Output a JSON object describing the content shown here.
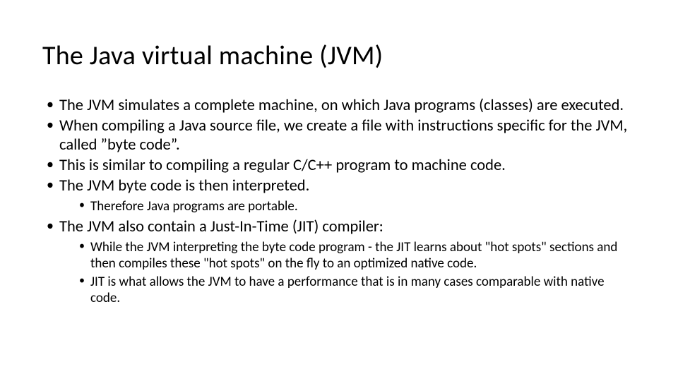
{
  "title": "The Java virtual machine (JVM)",
  "bullets": {
    "b1": "The JVM simulates a complete machine, on which Java programs (classes) are executed.",
    "b2": "When compiling a Java source file, we create a file with instructions specific for the JVM, called ”byte code”.",
    "b3": "This is similar to compiling a regular C/C++ program to machine code.",
    "b4": "The JVM byte code is then interpreted.",
    "b4_sub1": "Therefore Java programs are portable.",
    "b5": "The JVM also contain a Just-In-Time (JIT) compiler:",
    "b5_sub1": "While the JVM interpreting the byte code program - the JIT learns about \"hot spots\" sections and then compiles these \"hot spots\" on the fly to an optimized native code.",
    "b5_sub2": "JIT is what allows the JVM to have a performance that is in many cases comparable with native code."
  }
}
